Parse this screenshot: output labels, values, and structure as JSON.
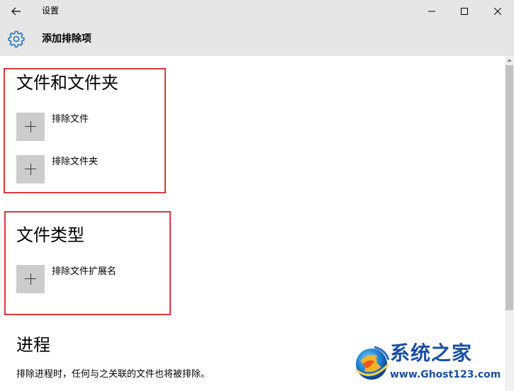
{
  "titlebar": {
    "title": "设置",
    "back_icon": "arrow-left-icon",
    "minimize_icon": "minimize-icon",
    "maximize_icon": "maximize-icon",
    "close_icon": "close-icon"
  },
  "header": {
    "icon": "gear-icon",
    "title": "添加排除项",
    "accent_color": "#1e73be"
  },
  "sections": {
    "files_folders": {
      "heading": "文件和文件夹",
      "items": [
        {
          "label": "排除文件",
          "icon": "plus-icon"
        },
        {
          "label": "排除文件夹",
          "icon": "plus-icon"
        }
      ]
    },
    "file_types": {
      "heading": "文件类型",
      "items": [
        {
          "label": "排除文件扩展名",
          "icon": "plus-icon"
        }
      ]
    },
    "processes": {
      "heading": "进程",
      "description": "排除进程时，任何与之关联的文件也将被排除。"
    }
  },
  "highlight_color": "#d9393b",
  "watermark": {
    "title": "系统之家",
    "url": "www.Ghost123.com"
  }
}
